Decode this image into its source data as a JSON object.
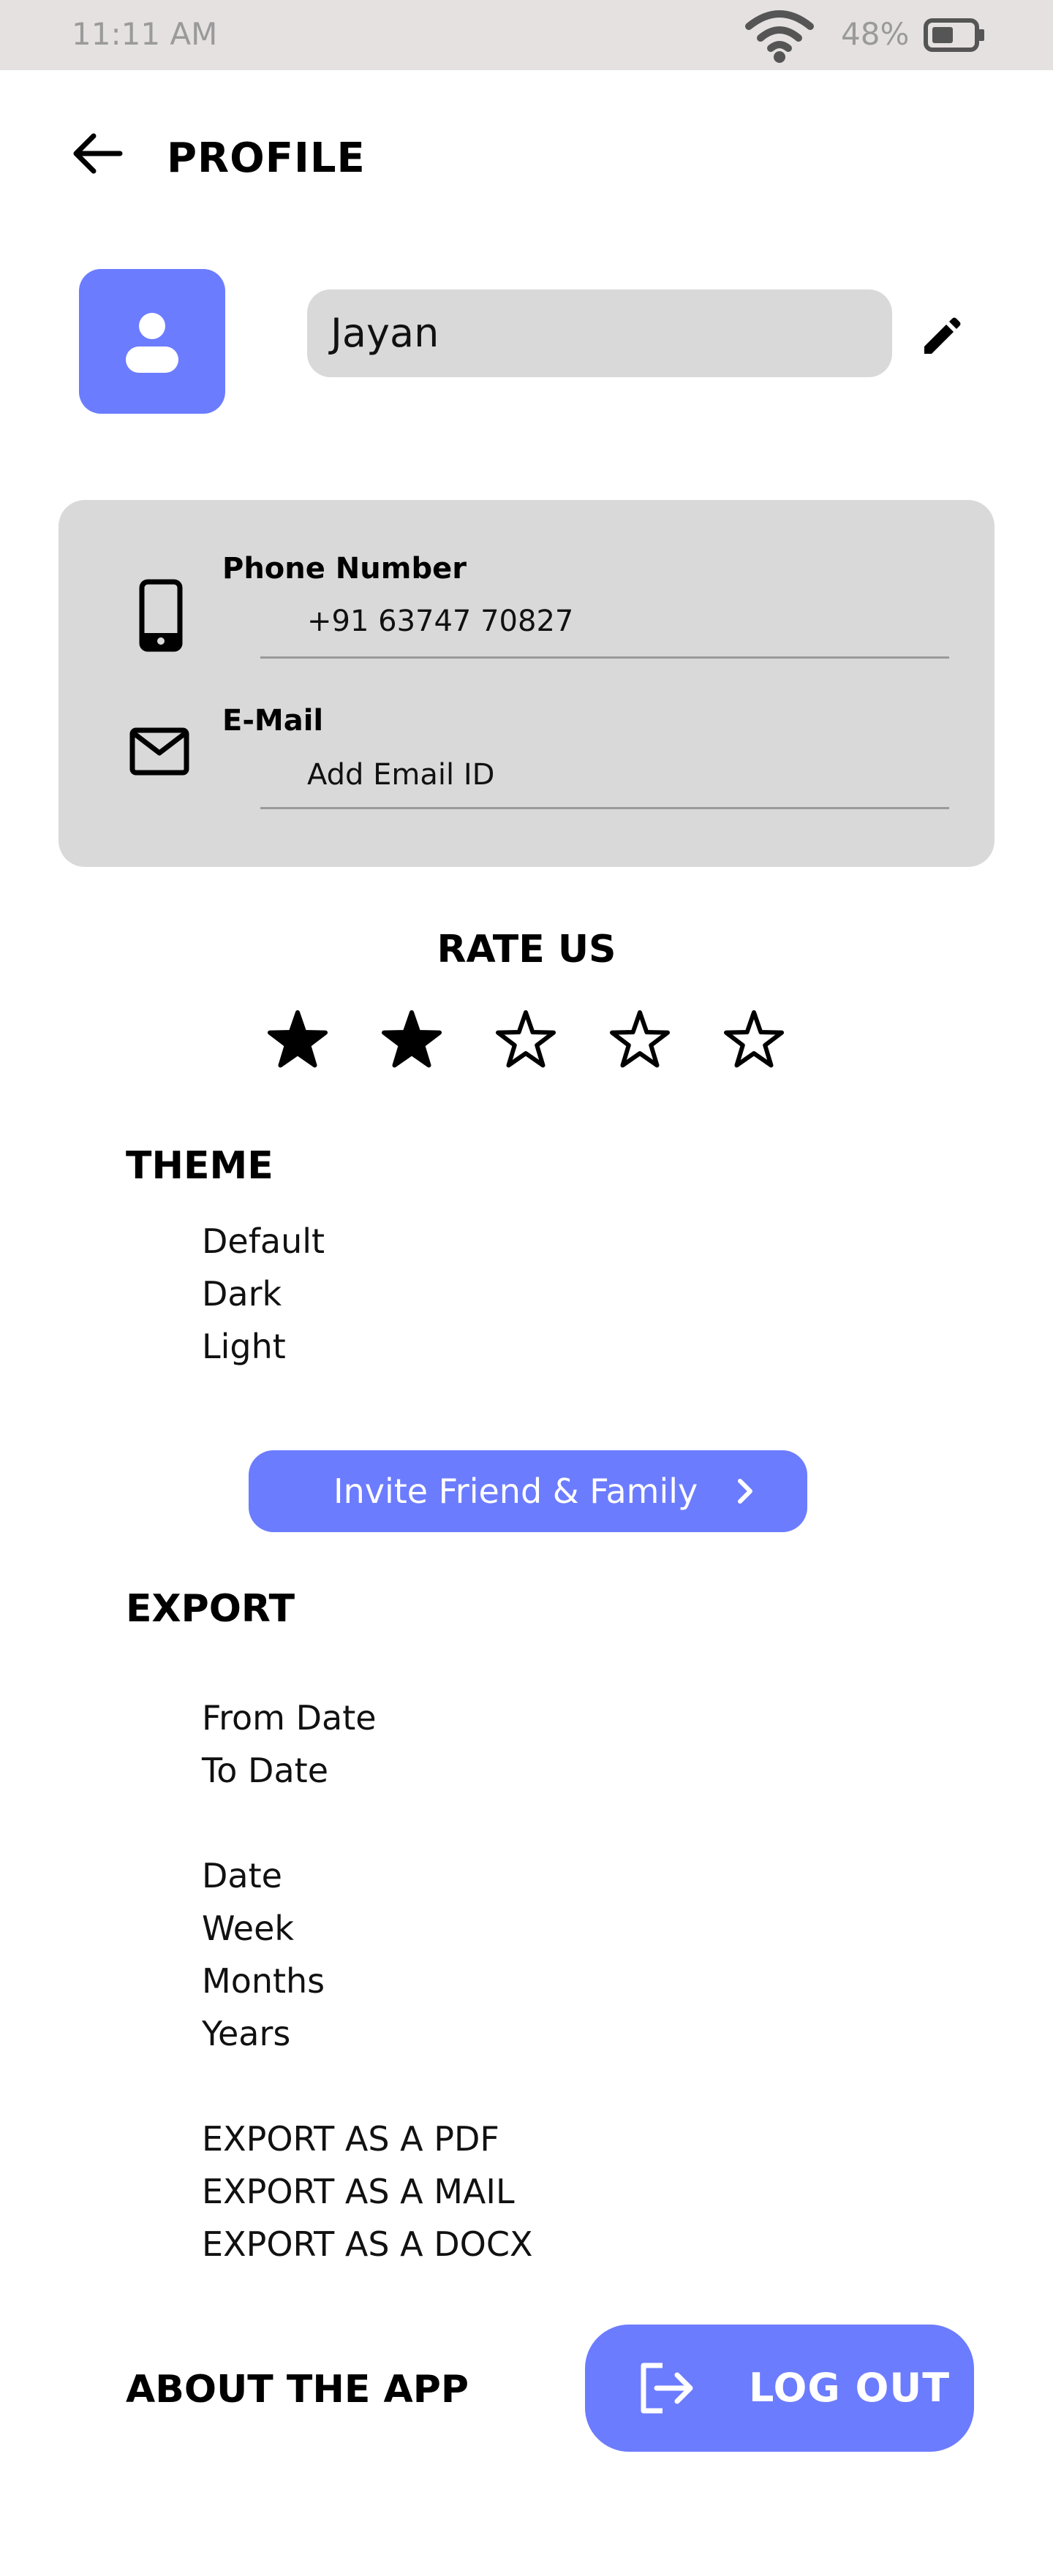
{
  "status_bar": {
    "time": "11:11 AM",
    "battery_percent": "48%",
    "icons": [
      "wifi-icon",
      "battery-icon"
    ]
  },
  "header": {
    "back_icon": "back-arrow-icon",
    "title": "PROFILE"
  },
  "profile": {
    "avatar_icon": "user-icon",
    "name": "Jayan",
    "edit_icon": "pencil-icon"
  },
  "contact": {
    "phone": {
      "icon": "phone-icon",
      "label": "Phone Number",
      "value": "+91 63747 70827"
    },
    "email": {
      "icon": "mail-icon",
      "label": "E-Mail",
      "placeholder": "Add Email ID"
    }
  },
  "rate_us": {
    "title": "RATE US",
    "rating": 2,
    "max": 5
  },
  "theme": {
    "title": "THEME",
    "options": [
      "Default",
      "Dark",
      "Light"
    ]
  },
  "invite": {
    "label": "Invite Friend & Family",
    "icon": "chevron-right-icon"
  },
  "export": {
    "title": "EXPORT",
    "date_range": [
      "From Date",
      "To Date"
    ],
    "periods": [
      "Date",
      "Week",
      "Months",
      "Years"
    ],
    "formats": [
      "EXPORT AS A PDF",
      "EXPORT AS A MAIL",
      "EXPORT AS A DOCX"
    ]
  },
  "about": {
    "label": "ABOUT THE APP"
  },
  "logout": {
    "label": "LOG OUT",
    "icon": "logout-icon"
  },
  "colors": {
    "accent": "#6c7cff",
    "status_bar_bg": "#e6e1e1",
    "field_bg": "#d9d9d9"
  }
}
